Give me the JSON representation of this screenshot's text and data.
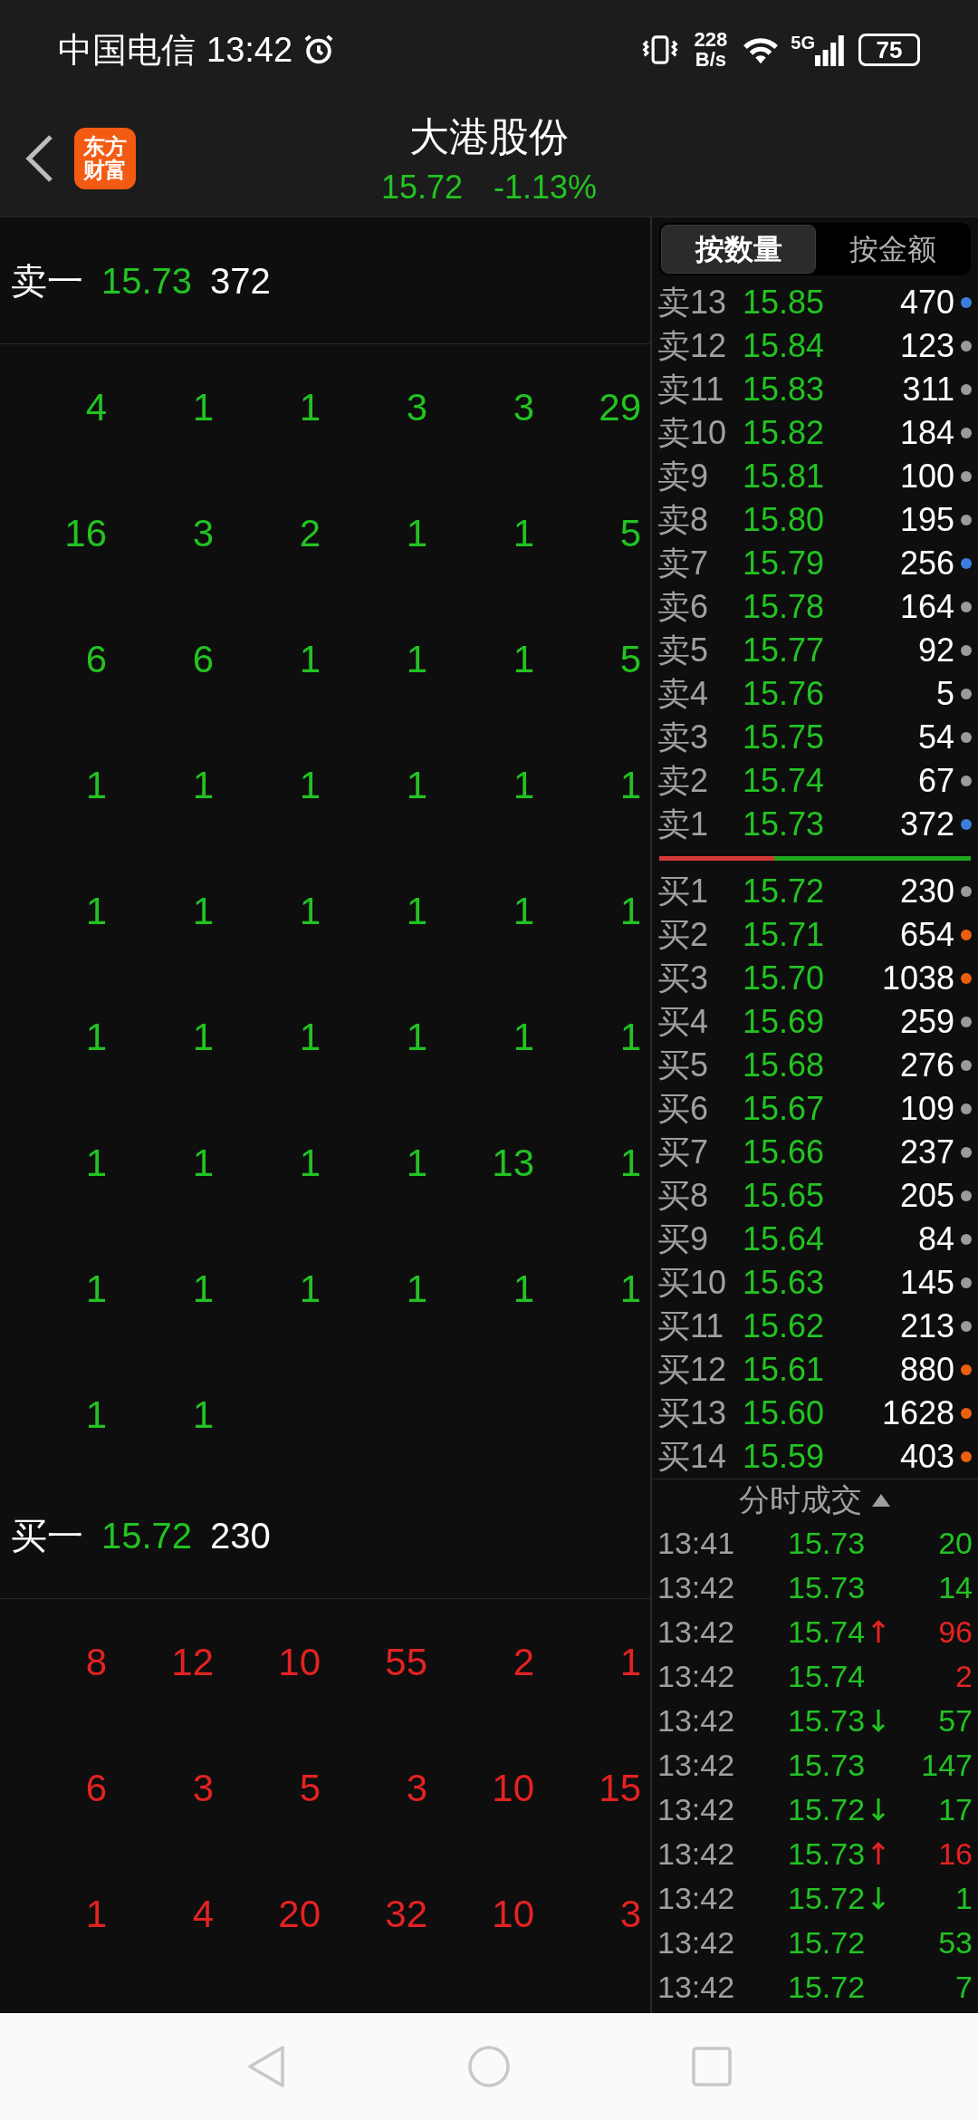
{
  "status_bar": {
    "carrier": "中国电信",
    "time": "13:42",
    "net_speed": "228",
    "net_unit": "B/s",
    "network": "5G",
    "battery": "75"
  },
  "header": {
    "logo": [
      "东方",
      "财富"
    ],
    "title": "大港股份",
    "price": "15.72",
    "change": "-1.13%"
  },
  "queue_levels": [
    {
      "label": "卖一",
      "price": "15.73",
      "volume": "372",
      "kind": "sell",
      "queue": [
        [
          "4",
          "1",
          "1",
          "3",
          "3",
          "29"
        ],
        [
          "16",
          "3",
          "2",
          "1",
          "1",
          "5"
        ],
        [
          "6",
          "6",
          "1",
          "1",
          "1",
          "5"
        ],
        [
          "1",
          "1",
          "1",
          "1",
          "1",
          "1"
        ],
        [
          "1",
          "1",
          "1",
          "1",
          "1",
          "1"
        ],
        [
          "1",
          "1",
          "1",
          "1",
          "1",
          "1"
        ],
        [
          "1",
          "1",
          "1",
          "1",
          "13",
          "1"
        ],
        [
          "1",
          "1",
          "1",
          "1",
          "1",
          "1"
        ],
        [
          "1",
          "1"
        ]
      ]
    },
    {
      "label": "买一",
      "price": "15.72",
      "volume": "230",
      "kind": "buy",
      "queue": [
        [
          "8",
          "12",
          "10",
          "55",
          "2",
          "1"
        ],
        [
          "6",
          "3",
          "5",
          "3",
          "10",
          "15"
        ],
        [
          "1",
          "4",
          "20",
          "32",
          "10",
          "3"
        ]
      ]
    }
  ],
  "tabs": [
    {
      "label": "按数量",
      "selected": true
    },
    {
      "label": "按金额",
      "selected": false
    }
  ],
  "asks": [
    {
      "label": "卖13",
      "price": "15.85",
      "volume": "470",
      "color": "#3b7ddd"
    },
    {
      "label": "卖12",
      "price": "15.84",
      "volume": "123",
      "color": "#9b9b9b"
    },
    {
      "label": "卖11",
      "price": "15.83",
      "volume": "311",
      "color": "#9b9b9b"
    },
    {
      "label": "卖10",
      "price": "15.82",
      "volume": "184",
      "color": "#9b9b9b"
    },
    {
      "label": "卖9",
      "price": "15.81",
      "volume": "100",
      "color": "#9b9b9b"
    },
    {
      "label": "卖8",
      "price": "15.80",
      "volume": "195",
      "color": "#9b9b9b"
    },
    {
      "label": "卖7",
      "price": "15.79",
      "volume": "256",
      "color": "#3b7ddd"
    },
    {
      "label": "卖6",
      "price": "15.78",
      "volume": "164",
      "color": "#9b9b9b"
    },
    {
      "label": "卖5",
      "price": "15.77",
      "volume": "92",
      "color": "#9b9b9b"
    },
    {
      "label": "卖4",
      "price": "15.76",
      "volume": "5",
      "color": "#9b9b9b"
    },
    {
      "label": "卖3",
      "price": "15.75",
      "volume": "54",
      "color": "#9b9b9b"
    },
    {
      "label": "卖2",
      "price": "15.74",
      "volume": "67",
      "color": "#9b9b9b"
    },
    {
      "label": "卖1",
      "price": "15.73",
      "volume": "372",
      "color": "#3b7ddd"
    }
  ],
  "ratio_bar": {
    "level": 0.37
  },
  "bids": [
    {
      "label": "买1",
      "price": "15.72",
      "volume": "230",
      "color": "#9b9b9b"
    },
    {
      "label": "买2",
      "price": "15.71",
      "volume": "654",
      "color": "#e8600f"
    },
    {
      "label": "买3",
      "price": "15.70",
      "volume": "1038",
      "color": "#e8600f"
    },
    {
      "label": "买4",
      "price": "15.69",
      "volume": "259",
      "color": "#9b9b9b"
    },
    {
      "label": "买5",
      "price": "15.68",
      "volume": "276",
      "color": "#9b9b9b"
    },
    {
      "label": "买6",
      "price": "15.67",
      "volume": "109",
      "color": "#9b9b9b"
    },
    {
      "label": "买7",
      "price": "15.66",
      "volume": "237",
      "color": "#9b9b9b"
    },
    {
      "label": "买8",
      "price": "15.65",
      "volume": "205",
      "color": "#9b9b9b"
    },
    {
      "label": "买9",
      "price": "15.64",
      "volume": "84",
      "color": "#9b9b9b"
    },
    {
      "label": "买10",
      "price": "15.63",
      "volume": "145",
      "color": "#9b9b9b"
    },
    {
      "label": "买11",
      "price": "15.62",
      "volume": "213",
      "color": "#9b9b9b"
    },
    {
      "label": "买12",
      "price": "15.61",
      "volume": "880",
      "color": "#e8600f"
    },
    {
      "label": "买13",
      "price": "15.60",
      "volume": "1628",
      "color": "#e8600f"
    },
    {
      "label": "买14",
      "price": "15.59",
      "volume": "403",
      "color": "#e8600f"
    }
  ],
  "trades": {
    "title": "分时成交",
    "rows": [
      {
        "time": "13:41",
        "price": "15.73",
        "kind": "none",
        "volume": "20",
        "color": "#22c322"
      },
      {
        "time": "13:42",
        "price": "15.73",
        "kind": "none",
        "volume": "14",
        "color": "#22c322"
      },
      {
        "time": "13:42",
        "price": "15.74",
        "kind": "up",
        "volume": "96",
        "color": "#e42222"
      },
      {
        "time": "13:42",
        "price": "15.74",
        "kind": "none",
        "volume": "2",
        "color": "#e42222"
      },
      {
        "time": "13:42",
        "price": "15.73",
        "kind": "down",
        "volume": "57",
        "color": "#22c322"
      },
      {
        "time": "13:42",
        "price": "15.73",
        "kind": "none",
        "volume": "147",
        "color": "#22c322"
      },
      {
        "time": "13:42",
        "price": "15.72",
        "kind": "down",
        "volume": "17",
        "color": "#22c322"
      },
      {
        "time": "13:42",
        "price": "15.73",
        "kind": "up",
        "volume": "16",
        "color": "#e42222"
      },
      {
        "time": "13:42",
        "price": "15.72",
        "kind": "down",
        "volume": "1",
        "color": "#22c322"
      },
      {
        "time": "13:42",
        "price": "15.72",
        "kind": "none",
        "volume": "53",
        "color": "#22c322"
      },
      {
        "time": "13:42",
        "price": "15.72",
        "kind": "none",
        "volume": "7",
        "color": "#22c322"
      }
    ]
  }
}
